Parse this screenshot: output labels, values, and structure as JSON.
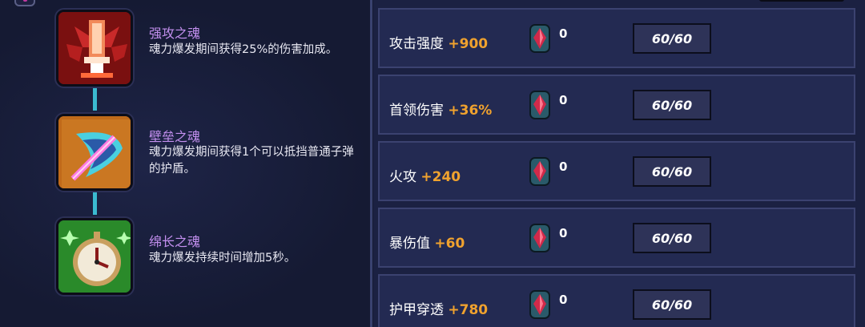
{
  "skills": [
    {
      "name": "强攻之魂",
      "desc": "魂力爆发期间获得25%的伤害加成。",
      "icon": "sword-icon"
    },
    {
      "name": "壁垒之魂",
      "desc": "魂力爆发期间获得1个可以抵挡普通子弹的护盾。",
      "icon": "shield-icon"
    },
    {
      "name": "绵长之魂",
      "desc": "魂力爆发持续时间增加5秒。",
      "icon": "stopwatch-icon"
    }
  ],
  "stats": [
    {
      "label": "攻击强度",
      "bonus": "+900",
      "gems": "0",
      "progress": "60/60"
    },
    {
      "label": "首领伤害",
      "bonus": "+36%",
      "gems": "0",
      "progress": "60/60"
    },
    {
      "label": "火攻",
      "bonus": "+240",
      "gems": "0",
      "progress": "60/60"
    },
    {
      "label": "暴伤值",
      "bonus": "+60",
      "gems": "0",
      "progress": "60/60"
    },
    {
      "label": "护甲穿透",
      "bonus": "+780",
      "gems": "0",
      "progress": "60/60"
    }
  ],
  "colors": {
    "accent": "#f0a22e",
    "skill_name": "#c490f0",
    "connector": "#3bbad0"
  }
}
